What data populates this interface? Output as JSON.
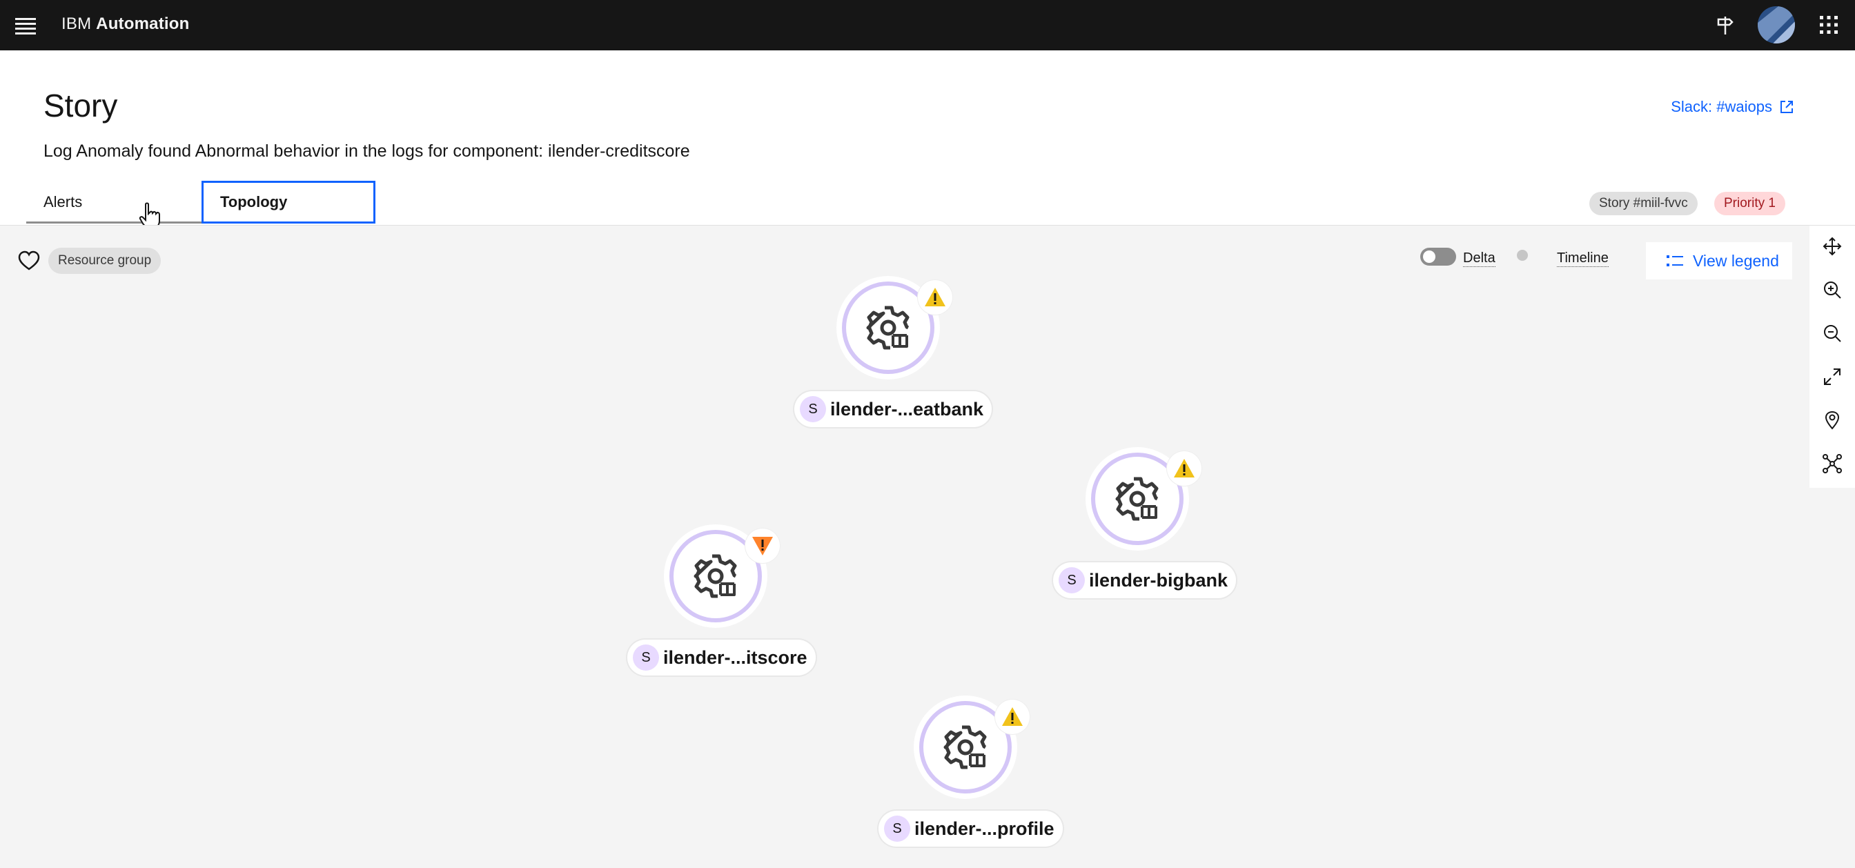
{
  "header": {
    "brand_prefix": "IBM",
    "brand_name": "Automation",
    "icons": [
      "menu-icon",
      "signpost-icon",
      "avatar",
      "app-switcher-icon"
    ]
  },
  "story": {
    "title": "Story",
    "description": "Log Anomaly found Abnormal behavior in the logs for component: ilender-creditscore",
    "slack_link": "Slack: #waiops",
    "tabs": [
      {
        "label": "Alerts",
        "selected": false
      },
      {
        "label": "Topology",
        "selected": true
      }
    ],
    "tags": {
      "story_id": "Story #miil-fvvc",
      "priority": "Priority 1"
    }
  },
  "topology": {
    "resource_group": "Resource group",
    "delta_label": "Delta",
    "delta_enabled": false,
    "timeline_label": "Timeline",
    "view_legend": "View legend",
    "tools": [
      "move-icon",
      "zoom-in-icon",
      "zoom-out-icon",
      "fit-to-screen-icon",
      "location-icon",
      "layout-icon"
    ],
    "nodes": [
      {
        "badge_letter": "S",
        "label": "ilender-...eatbank",
        "status": "warning"
      },
      {
        "badge_letter": "S",
        "label": "ilender-bigbank",
        "status": "warning"
      },
      {
        "badge_letter": "S",
        "label": "ilender-...itscore",
        "status": "major"
      },
      {
        "badge_letter": "S",
        "label": "ilender-...profile",
        "status": "warning"
      }
    ]
  },
  "colors": {
    "topbar_bg": "#161616",
    "link_blue": "#0f62fe",
    "node_ring": "#d4c6f7",
    "warning_yellow": "#f1c21b",
    "major_orange": "#ff832b",
    "priority_bg": "#ffd7d9",
    "priority_text": "#a2191f",
    "tab_underline_magenta": "#ee5396"
  }
}
